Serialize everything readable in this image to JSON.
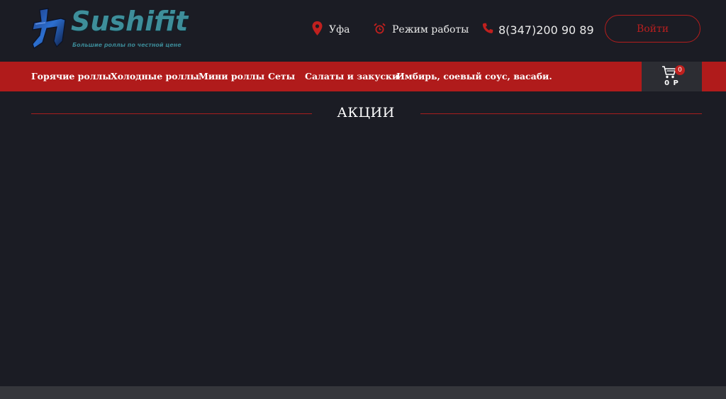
{
  "header": {
    "logo": {
      "brand": "Sushifit",
      "tagline": "Большие роллы по честной цене",
      "mark_icon": "kanji-chikara-logo"
    },
    "city": {
      "label": "Уфа",
      "icon": "map-pin-icon"
    },
    "hours": {
      "label": "Режим работы",
      "icon": "alarm-clock-icon"
    },
    "phone": {
      "label": "8(347)200 90 89",
      "icon": "phone-icon"
    },
    "login_label": "Войти"
  },
  "nav": {
    "items": [
      {
        "label": "Горячие роллы"
      },
      {
        "label": "Холодные роллы"
      },
      {
        "label": "Мини роллы"
      },
      {
        "label": "Сеты"
      },
      {
        "label": "Салаты и закуски"
      },
      {
        "label": "Имбирь, соевый соус, васаби."
      }
    ]
  },
  "cart": {
    "count": "0",
    "total": "0 Р",
    "icon": "shopping-cart-icon"
  },
  "main": {
    "section_title": "АКЦИИ"
  },
  "colors": {
    "background": "#1b1c24",
    "accent_red": "#b01b1b",
    "brand_teal": "#3e8e9a",
    "cart_bg": "#2c2d33",
    "footer": "#35363b"
  }
}
